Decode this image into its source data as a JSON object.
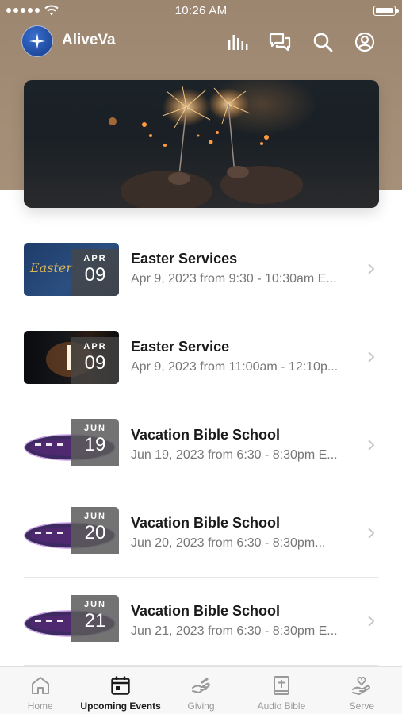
{
  "status_bar": {
    "time": "10:26 AM"
  },
  "app": {
    "name": "AliveVa"
  },
  "header_icons": [
    "audio-bars-icon",
    "chat-icon",
    "search-icon",
    "profile-icon"
  ],
  "events": [
    {
      "title": "Easter Services",
      "subtitle": "Apr 9, 2023 from 9:30 - 10:30am E...",
      "month": "APR",
      "day": "09",
      "thumb": "easter-graphic"
    },
    {
      "title": "Easter Service",
      "subtitle": "Apr 9, 2023 from 11:00am - 12:10p...",
      "month": "APR",
      "day": "09",
      "thumb": "cross-light"
    },
    {
      "title": "Vacation Bible School",
      "subtitle": "Jun 19, 2023 from 6:30 - 8:30pm E...",
      "month": "JUN",
      "day": "19",
      "thumb": "stellar-logo"
    },
    {
      "title": "Vacation Bible School",
      "subtitle": "Jun 20, 2023 from 6:30 - 8:30pm...",
      "month": "JUN",
      "day": "20",
      "thumb": "stellar-logo"
    },
    {
      "title": "Vacation Bible School",
      "subtitle": "Jun 21, 2023 from 6:30 - 8:30pm E...",
      "month": "JUN",
      "day": "21",
      "thumb": "stellar-logo"
    }
  ],
  "tabs": [
    {
      "label": "Home",
      "icon": "home-icon",
      "active": false
    },
    {
      "label": "Upcoming Events",
      "icon": "calendar-icon",
      "active": true
    },
    {
      "label": "Giving",
      "icon": "giving-hand-icon",
      "active": false
    },
    {
      "label": "Audio Bible",
      "icon": "bible-icon",
      "active": false
    },
    {
      "label": "Serve",
      "icon": "serve-heart-hand-icon",
      "active": false
    }
  ],
  "colors": {
    "header_tan": "#a38d76",
    "active_tab": "#1a1a1a",
    "inactive_tab": "#9a9a9a",
    "subtitle_gray": "#777777"
  }
}
